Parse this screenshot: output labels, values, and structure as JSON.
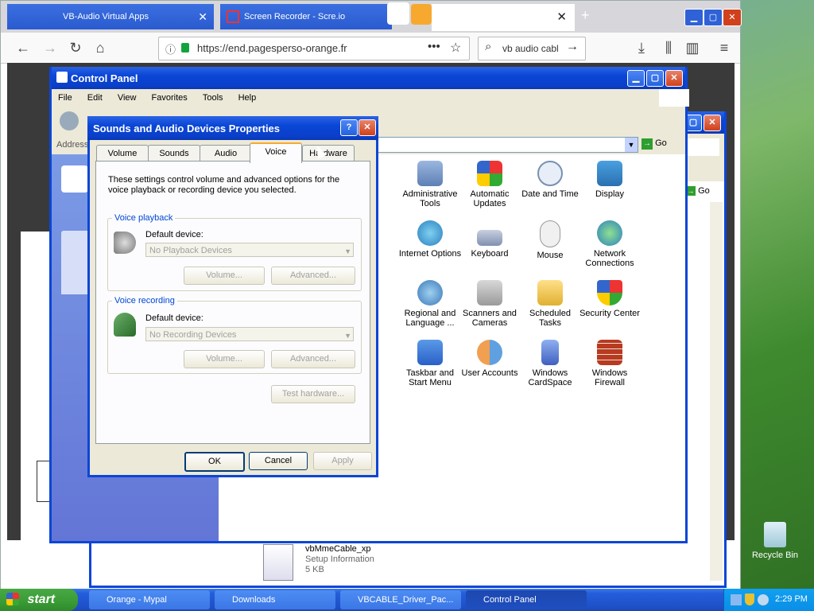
{
  "firefox": {
    "tabs": [
      {
        "label": "VB-Audio Virtual Apps"
      },
      {
        "label": "Screen Recorder - Scre.io"
      }
    ],
    "new_tab_symbol": "+",
    "url": "https://end.pagesperso-orange.fr",
    "search_value": "vb audio cabl",
    "icons": {
      "back": "back-arrow-icon",
      "forward": "forward-arrow-icon",
      "reload": "reload-icon",
      "home": "home-icon",
      "lock": "lock-icon",
      "menu": "hamburger-menu-icon"
    }
  },
  "control_panel": {
    "title": "Control Panel",
    "menu": [
      "File",
      "Edit",
      "View",
      "Favorites",
      "Tools",
      "Help"
    ],
    "address_label": "Address",
    "go_label": "Go",
    "items": [
      {
        "label": "Administrative Tools"
      },
      {
        "label": "Automatic Updates"
      },
      {
        "label": "Date and Time"
      },
      {
        "label": "Display"
      },
      {
        "label": "Internet Options"
      },
      {
        "label": "Keyboard"
      },
      {
        "label": "Mouse"
      },
      {
        "label": "Network Connections"
      },
      {
        "label": "Regional and Language ..."
      },
      {
        "label": "Scanners and Cameras"
      },
      {
        "label": "Scheduled Tasks"
      },
      {
        "label": "Security Center"
      },
      {
        "label": "Taskbar and Start Menu"
      },
      {
        "label": "User Accounts"
      },
      {
        "label": "Windows CardSpace"
      },
      {
        "label": "Windows Firewall"
      }
    ]
  },
  "second_window": {
    "go_label": "Go",
    "file_name": "vbMmeCable_xp",
    "file_type": "Setup Information",
    "file_size": "5 KB"
  },
  "dialog": {
    "title": "Sounds and Audio Devices Properties",
    "tabs": [
      "Volume",
      "Sounds",
      "Audio",
      "Voice",
      "Hardware"
    ],
    "active_tab": "Voice",
    "description": "These settings control volume and advanced options for the voice playback or recording device you selected.",
    "playback": {
      "group_label": "Voice playback",
      "default_device_label": "Default device:",
      "device_value": "No Playback Devices",
      "volume_button": "Volume...",
      "advanced_button": "Advanced..."
    },
    "recording": {
      "group_label": "Voice recording",
      "default_device_label": "Default device:",
      "device_value": "No Recording Devices",
      "volume_button": "Volume...",
      "advanced_button": "Advanced..."
    },
    "test_hardware_button": "Test hardware...",
    "ok_button": "OK",
    "cancel_button": "Cancel",
    "apply_button": "Apply",
    "help_symbol": "?",
    "close_symbol": "✕"
  },
  "desktop": {
    "recycle_bin_label": "Recycle Bin"
  },
  "taskbar": {
    "start_label": "start",
    "tasks": [
      {
        "label": "Orange - Mypal"
      },
      {
        "label": "Downloads"
      },
      {
        "label": "VBCABLE_Driver_Pac..."
      },
      {
        "label": "Control Panel"
      }
    ],
    "clock": "2:29 PM"
  }
}
